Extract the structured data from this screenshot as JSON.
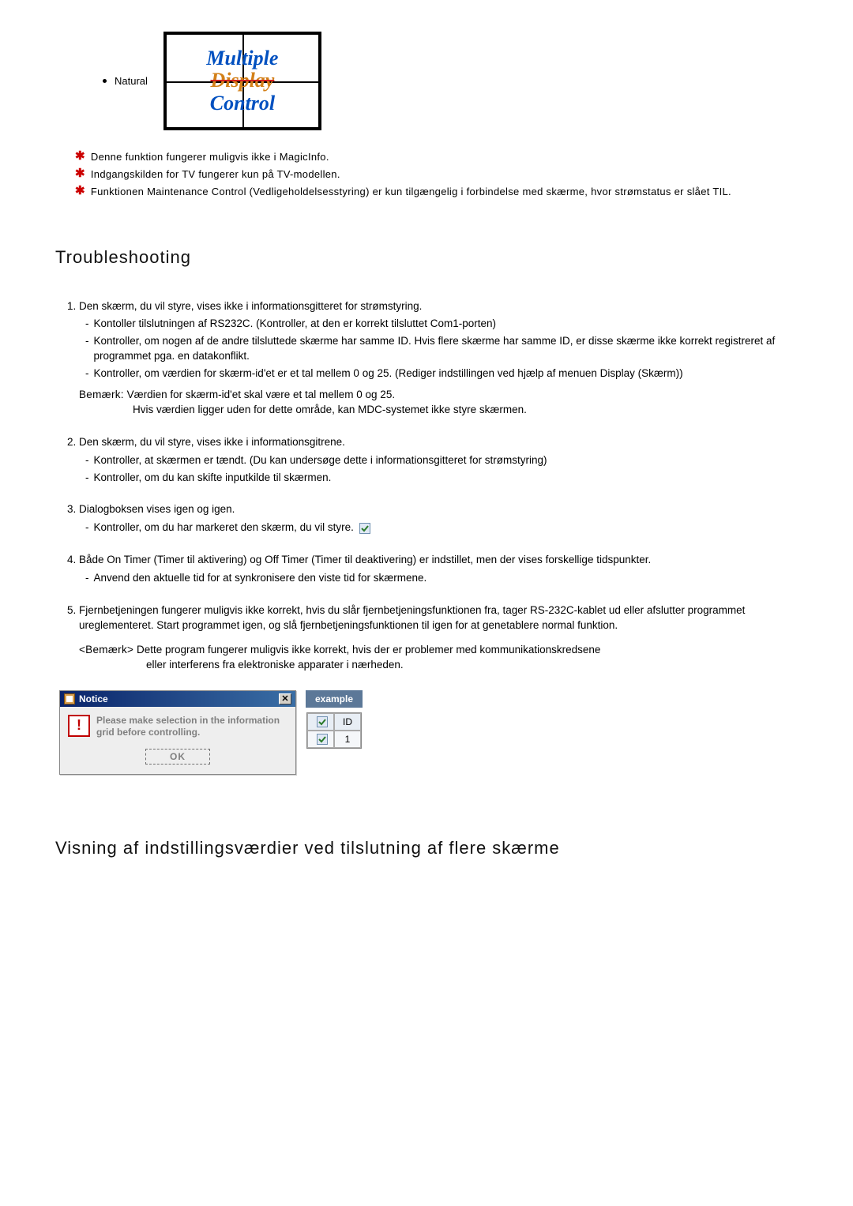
{
  "topList": {
    "label": "Natural",
    "logoLines": [
      "Multiple",
      "Display",
      "Control"
    ]
  },
  "notes": [
    "Denne funktion fungerer muligvis ikke i MagicInfo.",
    "Indgangskilden for TV fungerer kun på TV-modellen.",
    "Funktionen Maintenance Control (Vedligeholdelsesstyring) er kun tilgængelig i forbindelse med skærme, hvor strømstatus er slået TIL."
  ],
  "troubleshootHeading": "Troubleshooting",
  "troubleshoot": [
    {
      "title": "Den skærm, du vil styre, vises ikke i informationsgitteret for strømstyring.",
      "subs": [
        "Kontoller tilslutningen af RS232C. (Kontroller, at den er korrekt tilsluttet Com1-porten)",
        "Kontroller, om nogen af de andre tilsluttede skærme har samme ID. Hvis flere skærme har samme ID, er disse skærme ikke korrekt registreret af programmet pga. en datakonflikt.",
        "Kontroller, om værdien for skærm-id'et er et tal mellem 0 og 25. (Rediger indstillingen ved hjælp af menuen Display (Skærm))"
      ],
      "remarkLabel": "Bemærk:",
      "remark1": "Værdien for skærm-id'et skal være et tal mellem 0 og 25.",
      "remark2": "Hvis værdien ligger uden for dette område, kan MDC-systemet ikke styre skærmen."
    },
    {
      "title": "Den skærm, du vil styre, vises ikke i informationsgitrene.",
      "subs": [
        "Kontroller, at skærmen er tændt. (Du kan undersøge dette i informationsgitteret for strømstyring)",
        "Kontroller, om du kan skifte inputkilde til skærmen."
      ]
    },
    {
      "title": "Dialogboksen vises igen og igen.",
      "subs": [
        "Kontroller, om du har markeret den skærm, du vil styre."
      ],
      "hasCheckbox": true
    },
    {
      "title": "Både On Timer (Timer til aktivering) og Off Timer (Timer til deaktivering) er indstillet, men der vises forskellige tidspunkter.",
      "subs": [
        "Anvend den aktuelle tid for at synkronisere den viste tid for skærmene."
      ]
    },
    {
      "title": "Fjernbetjeningen fungerer muligvis ikke korrekt, hvis du slår fjernbetjeningsfunktionen fra, tager RS-232C-kablet ud eller afslutter programmet ureglementeret. Start programmet igen, og slå fjernbetjeningsfunktionen til igen for at genetablere normal funktion.",
      "subs": [],
      "finalLabel": "<Bemærk>",
      "final1": "Dette program fungerer muligvis ikke korrekt, hvis der er problemer med kommunikationskredsene",
      "final2": "eller interferens fra elektroniske apparater i nærheden."
    }
  ],
  "dialog": {
    "title": "Notice",
    "message": "Please make selection in the information grid before controlling.",
    "ok": "OK",
    "close": "✕"
  },
  "example": {
    "label": "example",
    "headerId": "ID",
    "rowValue": "1"
  },
  "bottomHeading": "Visning af indstillingsværdier ved tilslutning af flere skærme"
}
